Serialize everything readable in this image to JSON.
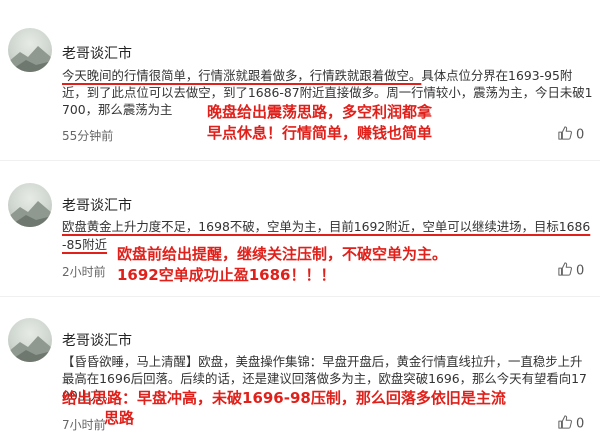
{
  "posts": [
    {
      "author": "老哥谈汇市",
      "underlined": "今天晚间的行情很简单，行情涨就跟着做多，行情跌就跟着做空。",
      "rest": "具体点位分界在1693-95附近，到了此点位可以去做空，到了1686-87附近直接做多。周一行情较小，震荡为主，今日未破1700，那么震荡为主",
      "note_lines": [
        "晚盘给出震荡思路，多空利润都拿",
        "早点休息！行情简单，赚钱也简单"
      ],
      "time": "55分钟前",
      "likes": "0"
    },
    {
      "author": "老哥谈汇市",
      "underlined": "欧盘黄金上升力度不足，1698不破，空单为主，目前1692附近，空单可以继续进场，目标1686-85附近",
      "note_lines": [
        "欧盘前给出提醒，继续关注压制，不破空单为主。",
        "1692空单成功止盈1686！！！"
      ],
      "time": "2小时前",
      "likes": "0"
    },
    {
      "author": "老哥谈汇市",
      "text": "【昏昏欲睡，马上清醒】欧盘，美盘操作集锦：早盘开盘后，黄金行情直线拉升，一直稳步上升最高在1696后回落。后续的话，还是建议回落做多为主，欧盘突破1696，那么今天有望看向1700上方。",
      "note_lines": [
        "给出思路：早盘冲高，未破1696-98压制，那么回落多依旧是主流",
        "思路"
      ],
      "time": "7小时前",
      "likes": "0"
    }
  ]
}
